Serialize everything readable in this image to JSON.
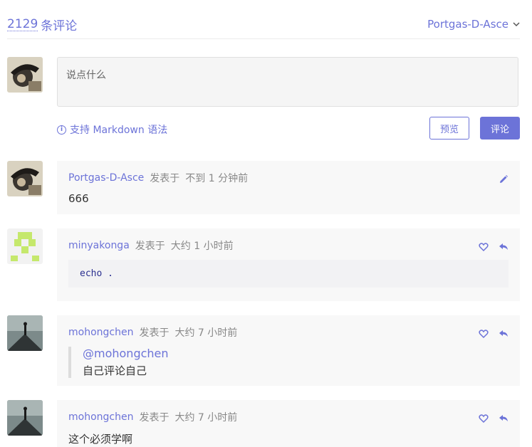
{
  "header": {
    "count": "2129",
    "count_suffix": "条评论",
    "username": "Portgas-D-Asce",
    "menu_icon": "chevron-down-icon"
  },
  "editor": {
    "placeholder": "说点什么",
    "markdown_hint": "支持 Markdown 语法",
    "preview_label": "预览",
    "submit_label": "评论"
  },
  "comments": [
    {
      "author": "Portgas-D-Asce",
      "posted_label": "发表于",
      "time": "不到 1 分钟前",
      "text": "666",
      "actions": [
        "edit-icon"
      ]
    },
    {
      "author": "minyakonga",
      "posted_label": "发表于",
      "time": "大约 1 小时前",
      "code": "echo .",
      "actions": [
        "heart-icon",
        "reply-icon"
      ]
    },
    {
      "author": "mohongchen",
      "posted_label": "发表于",
      "time": "大约 7 小时前",
      "mention": "@mohongchen",
      "quote_text": "自己评论自己",
      "actions": [
        "heart-icon",
        "reply-icon"
      ]
    },
    {
      "author": "mohongchen",
      "posted_label": "发表于",
      "time": "大约 7 小时前",
      "text": "这个必须学啊",
      "actions": [
        "heart-icon",
        "reply-icon"
      ]
    }
  ],
  "colors": {
    "accent": "#6c73d8",
    "card_bg": "#f8f8f8",
    "text": "#333333"
  }
}
